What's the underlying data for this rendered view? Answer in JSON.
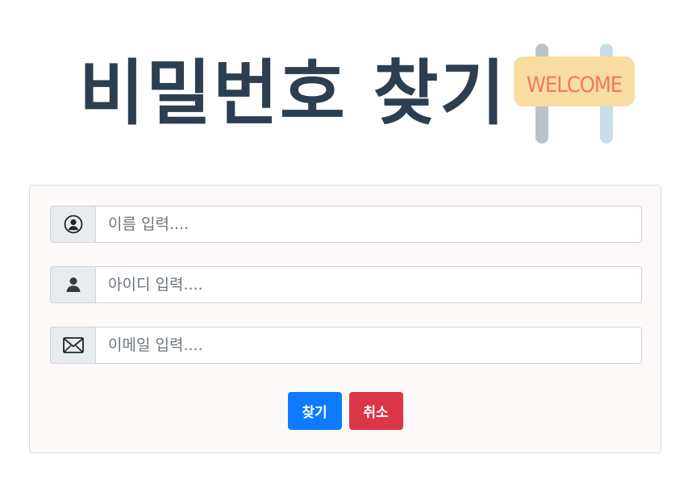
{
  "page": {
    "title": "비밀번호 찾기",
    "welcome_sign_text": "WELCOME"
  },
  "form": {
    "fields": [
      {
        "icon": "user-circle-icon",
        "value": "",
        "placeholder": "이름 입력...."
      },
      {
        "icon": "user-icon",
        "value": "",
        "placeholder": "아이디 입력...."
      },
      {
        "icon": "envelope-icon",
        "value": "",
        "placeholder": "이메일 입력...."
      }
    ],
    "find_label": "찾기",
    "cancel_label": "취소"
  },
  "colors": {
    "title": "#2c3e50",
    "primary": "#0d7bff",
    "danger": "#dc3545",
    "card_background": "#fdf9f8",
    "sign_board": "#f9dca0",
    "sign_text": "#ef7a5e"
  }
}
